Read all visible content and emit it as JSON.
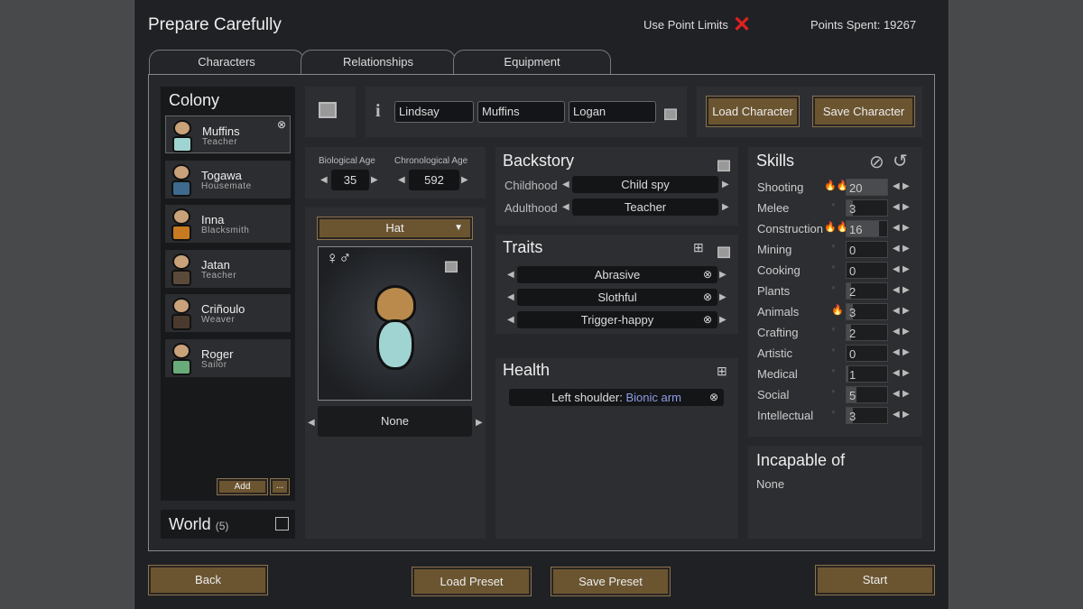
{
  "title": "Prepare Carefully",
  "point_limits": {
    "label": "Use Point Limits",
    "icon": "red-x-icon",
    "color": "#e02020"
  },
  "points_spent": "Points Spent: 19267",
  "tabs": [
    "Characters",
    "Relationships",
    "Equipment"
  ],
  "colony": {
    "title": "Colony",
    "colonists": [
      {
        "name": "Muffins",
        "job": "Teacher",
        "selected": true,
        "color": "#9fd4d2"
      },
      {
        "name": "Togawa",
        "job": "Housemate",
        "color": "#3d6a8e"
      },
      {
        "name": "Inna",
        "job": "Blacksmith",
        "color": "#c77a20"
      },
      {
        "name": "Jatan",
        "job": "Teacher",
        "color": "#5a4a3a"
      },
      {
        "name": "Criñoulo",
        "job": "Weaver",
        "color": "#4a3a2e"
      },
      {
        "name": "Roger",
        "job": "Sailor",
        "color": "#6aab7a"
      }
    ],
    "add": "Add",
    "more": "..."
  },
  "world": {
    "title": "World",
    "count": "(5)"
  },
  "names": {
    "first": "Lindsay",
    "nick": "Muffins",
    "last": "Logan"
  },
  "buttons": {
    "load_character": "Load Character",
    "save_character": "Save Character",
    "back": "Back",
    "load_preset": "Load Preset",
    "save_preset": "Save Preset",
    "start": "Start"
  },
  "ages": {
    "bio_label": "Biological Age",
    "bio": "35",
    "chrono_label": "Chronological Age",
    "chrono": "592"
  },
  "apparel": {
    "layer": "Hat",
    "item": "None",
    "gender_icons": "♀♂"
  },
  "backstory": {
    "title": "Backstory",
    "childhood_label": "Childhood",
    "childhood": "Child spy",
    "adulthood_label": "Adulthood",
    "adulthood": "Teacher"
  },
  "traits": {
    "title": "Traits",
    "items": [
      "Abrasive",
      "Slothful",
      "Trigger-happy"
    ]
  },
  "health": {
    "title": "Health",
    "items": [
      {
        "part": "Left shoulder:",
        "value": "Bionic arm",
        "value_color": "#8f9be8"
      }
    ]
  },
  "skills": {
    "title": "Skills",
    "items": [
      {
        "name": "Shooting",
        "level": "20",
        "passion": 2
      },
      {
        "name": "Melee",
        "level": "3",
        "passion": 0
      },
      {
        "name": "Construction",
        "level": "16",
        "passion": 2
      },
      {
        "name": "Mining",
        "level": "0",
        "passion": 0
      },
      {
        "name": "Cooking",
        "level": "0",
        "passion": 0
      },
      {
        "name": "Plants",
        "level": "2",
        "passion": 0
      },
      {
        "name": "Animals",
        "level": "3",
        "passion": 1
      },
      {
        "name": "Crafting",
        "level": "2",
        "passion": 0
      },
      {
        "name": "Artistic",
        "level": "0",
        "passion": 0
      },
      {
        "name": "Medical",
        "level": "1",
        "passion": 0
      },
      {
        "name": "Social",
        "level": "5",
        "passion": 0
      },
      {
        "name": "Intellectual",
        "level": "3",
        "passion": 0
      }
    ]
  },
  "incapable": {
    "title": "Incapable of",
    "value": "None"
  }
}
